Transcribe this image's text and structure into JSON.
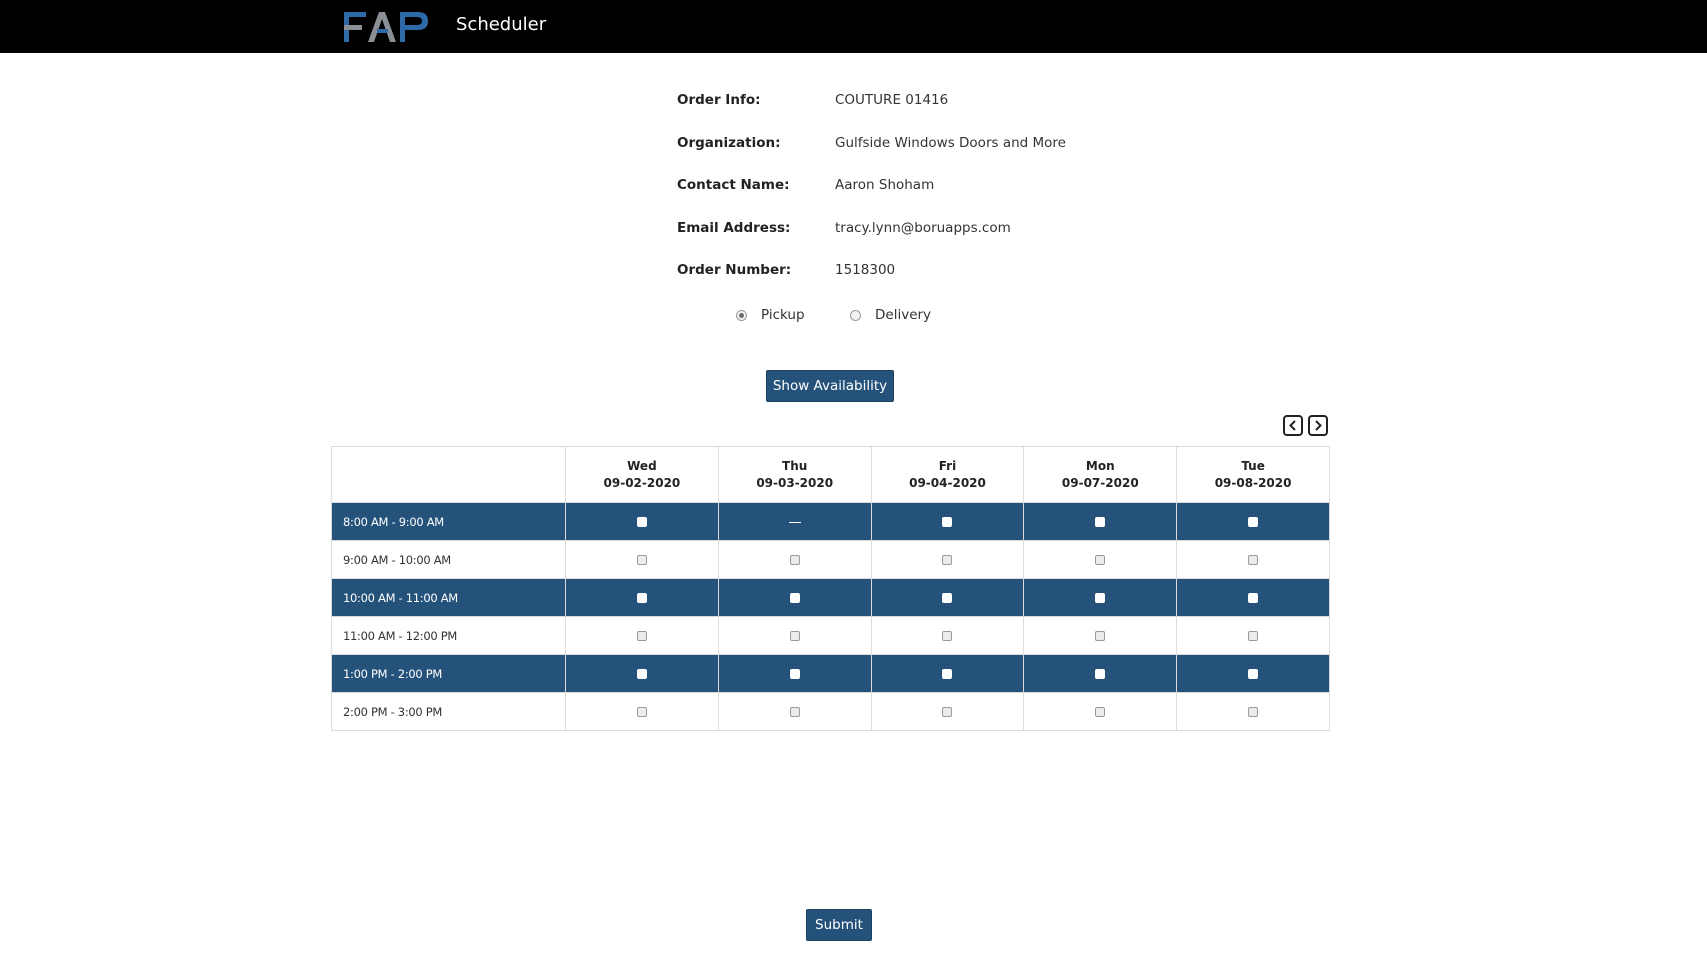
{
  "header": {
    "logo_text": "FAP",
    "app_title": "Scheduler"
  },
  "order": {
    "fields": [
      {
        "label": "Order Info:",
        "value": "COUTURE 01416"
      },
      {
        "label": "Organization:",
        "value": "Gulfside Windows Doors and More"
      },
      {
        "label": "Contact Name:",
        "value": "Aaron Shoham"
      },
      {
        "label": "Email Address:",
        "value": "tracy.lynn@boruapps.com"
      },
      {
        "label": "Order Number:",
        "value": "1518300"
      }
    ]
  },
  "method": {
    "options": [
      {
        "label": "Pickup",
        "selected": true
      },
      {
        "label": "Delivery",
        "selected": false
      }
    ]
  },
  "buttons": {
    "show_availability": "Show Availability",
    "submit": "Submit"
  },
  "schedule": {
    "days": [
      {
        "day": "Wed",
        "date": "09-02-2020"
      },
      {
        "day": "Thu",
        "date": "09-03-2020"
      },
      {
        "day": "Fri",
        "date": "09-04-2020"
      },
      {
        "day": "Mon",
        "date": "09-07-2020"
      },
      {
        "day": "Tue",
        "date": "09-08-2020"
      }
    ],
    "slots": [
      {
        "time": "8:00 AM - 9:00 AM",
        "available": [
          true,
          false,
          true,
          true,
          true
        ]
      },
      {
        "time": "9:00 AM - 10:00 AM",
        "available": [
          true,
          true,
          true,
          true,
          true
        ]
      },
      {
        "time": "10:00 AM - 11:00 AM",
        "available": [
          true,
          true,
          true,
          true,
          true
        ]
      },
      {
        "time": "11:00 AM - 12:00 PM",
        "available": [
          true,
          true,
          true,
          true,
          true
        ]
      },
      {
        "time": "1:00 PM - 2:00 PM",
        "available": [
          true,
          true,
          true,
          true,
          true
        ]
      },
      {
        "time": "2:00 PM - 3:00 PM",
        "available": [
          true,
          true,
          true,
          true,
          true
        ]
      }
    ],
    "unavailable_marker": "—"
  },
  "colors": {
    "header_bg": "#000000",
    "accent": "#24527a",
    "logo_blue": "#2f6aa8",
    "logo_gray": "#8a8f96"
  }
}
